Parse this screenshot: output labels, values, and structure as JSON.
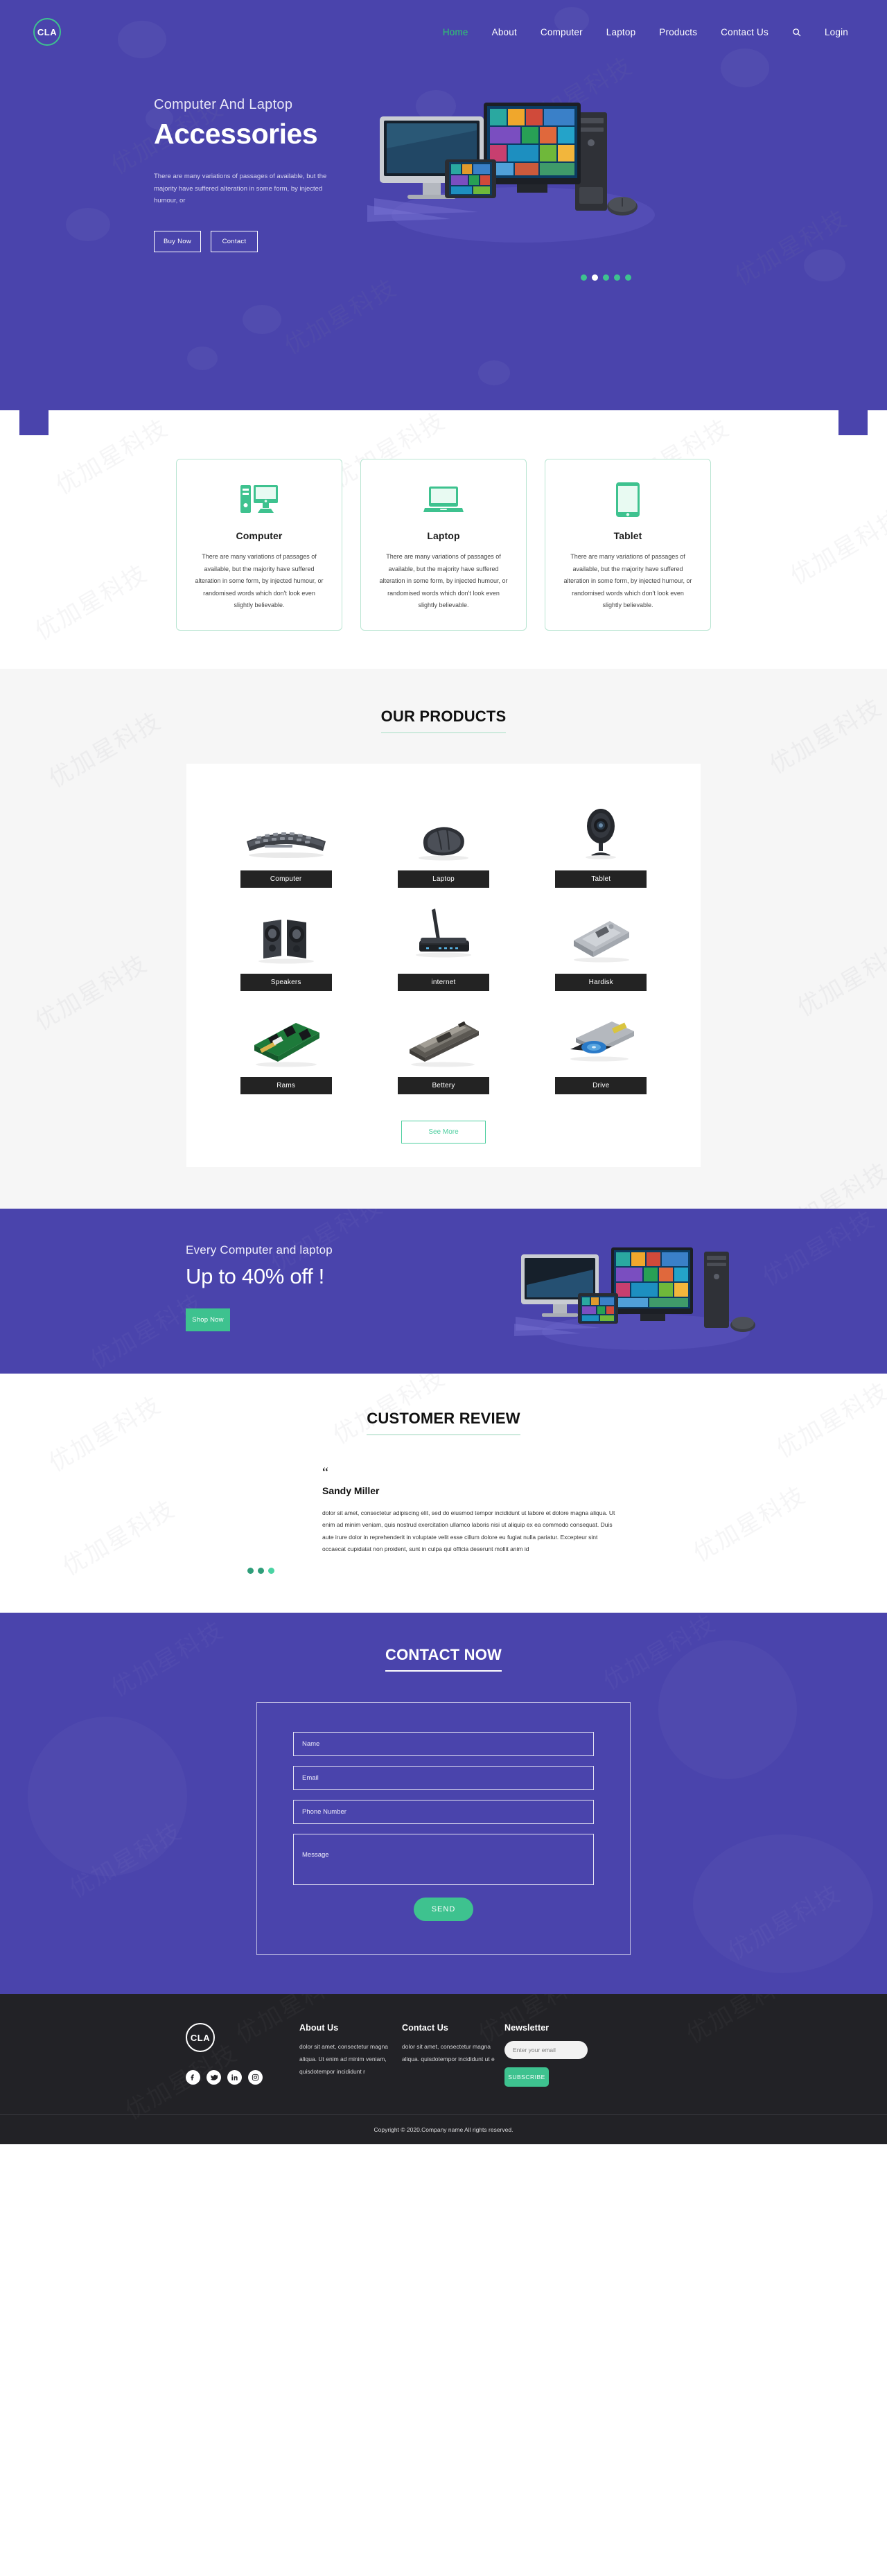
{
  "brand": {
    "logo_text": "CLA"
  },
  "nav": {
    "items": [
      {
        "label": "Home",
        "active": true
      },
      {
        "label": "About",
        "active": false
      },
      {
        "label": "Computer",
        "active": false
      },
      {
        "label": "Laptop",
        "active": false
      },
      {
        "label": "Products",
        "active": false
      },
      {
        "label": "Contact Us",
        "active": false
      }
    ],
    "search_icon": "search-icon",
    "login_label": "Login"
  },
  "hero": {
    "subtitle": "Computer And Laptop",
    "title": "Accessories",
    "paragraph": "There are many variations of passages of available, but the majority have suffered alteration in some form, by injected humour, or",
    "primary_button": "Buy Now",
    "secondary_button": "Contact",
    "carousel": {
      "total": 5,
      "active_index": 1
    }
  },
  "features": {
    "cards": [
      {
        "icon": "desktop-computer-icon",
        "title": "Computer",
        "text": "There are many variations of passages of available, but the majority have suffered alteration in some form, by injected humour, or randomised words which don't look even slightly believable."
      },
      {
        "icon": "laptop-icon",
        "title": "Laptop",
        "text": "There are many variations of passages of available, but the majority have suffered alteration in some form, by injected humour, or randomised words which don't look even slightly believable."
      },
      {
        "icon": "tablet-icon",
        "title": "Tablet",
        "text": "There are many variations of passages of available, but the majority have suffered alteration in some form, by injected humour, or randomised words which don't look even slightly believable."
      }
    ]
  },
  "products": {
    "section_title": "OUR PRODUCTS",
    "items": [
      {
        "label": "Computer",
        "image": "keyboard-photo"
      },
      {
        "label": "Laptop",
        "image": "mouse-photo"
      },
      {
        "label": "Tablet",
        "image": "webcam-photo"
      },
      {
        "label": "Speakers",
        "image": "speakers-photo"
      },
      {
        "label": "internet",
        "image": "wifi-router-photo"
      },
      {
        "label": "Hardisk",
        "image": "hard-drive-photo"
      },
      {
        "label": "Rams",
        "image": "ram-modules-photo"
      },
      {
        "label": "Bettery",
        "image": "laptop-battery-photo"
      },
      {
        "label": "Drive",
        "image": "optical-drive-photo"
      }
    ],
    "see_more_label": "See More"
  },
  "promo": {
    "small_title": "Every Computer and laptop",
    "big_title": "Up to 40% off !",
    "button_label": "Shop Now"
  },
  "review": {
    "section_title": "CUSTOMER REVIEW",
    "quote_glyph": "“",
    "author": "Sandy Miller",
    "text": "dolor sit amet, consectetur adipiscing elit, sed do eiusmod tempor incididunt ut labore et dolore magna aliqua. Ut enim ad minim veniam, quis nostrud exercitation ullamco laboris nisi ut aliquip ex ea commodo consequat. Duis aute irure dolor in reprehenderit in voluptate velit esse cillum dolore eu fugiat nulla pariatur. Excepteur sint occaecat cupidatat non proident, sunt in culpa qui officia deserunt mollit anim id",
    "carousel": {
      "total": 3,
      "active_index": 2
    }
  },
  "contact": {
    "section_title": "CONTACT NOW",
    "fields": {
      "name_placeholder": "Name",
      "email_placeholder": "Email",
      "phone_placeholder": "Phone Number",
      "message_placeholder": "Message"
    },
    "submit_label": "SEND"
  },
  "footer": {
    "logo_text": "CLA",
    "socials": [
      {
        "name": "facebook-icon"
      },
      {
        "name": "twitter-icon"
      },
      {
        "name": "linkedin-icon"
      },
      {
        "name": "instagram-icon"
      }
    ],
    "about": {
      "title": "About Us",
      "text": "dolor sit amet, consectetur magna aliqua. Ut enim ad minim veniam, quisdotempor incididunt r"
    },
    "contact": {
      "title": "Contact Us",
      "text": "dolor sit amet, consectetur magna aliqua. quisdotempor incididunt ut e"
    },
    "newsletter": {
      "title": "Newsletter",
      "email_placeholder": "Enter your email",
      "button_label": "SUBSCRIBE"
    },
    "copyright": "Copyright © 2020.Company name All rights reserved."
  },
  "colors": {
    "purple": "#4a44ac",
    "green": "#3ec28f",
    "accent_green": "#2ecb6f",
    "dark": "#222226",
    "panel_grey": "#f6f6f6"
  },
  "watermark": "优加星科技"
}
